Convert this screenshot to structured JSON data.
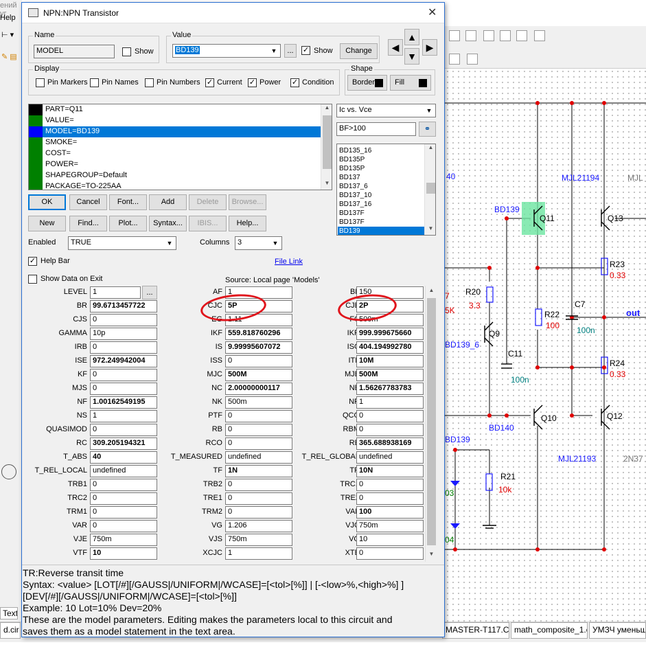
{
  "background": {
    "left_menu": [
      "ений уг",
      "Help"
    ],
    "labels_blue": [
      "BD139",
      "MJL21194",
      "BD140",
      "MJL21193",
      "BD139_6",
      "out",
      "BD139",
      "03",
      "04",
      "40"
    ],
    "components": {
      "q11": "Q11",
      "q13": "Q13",
      "q9": "Q9",
      "q10": "Q10",
      "q12": "Q12",
      "r20": "R20",
      "r20_val": "3.3",
      "r22": "R22",
      "r22_val": "100",
      "r23": "R23",
      "r23_val": "0.33",
      "r24": "R24",
      "r24_val": "0.33",
      "c7": "C7",
      "c7_val": "100n",
      "c11": "C11",
      "c11_val": "100n",
      "r21": "R21",
      "r21_val": "10k",
      "gray1": "MJL",
      "gray2": "2N37",
      "partial_5k": "5K",
      "partial_7": "7"
    },
    "tabs": [
      "d.cir",
      "MASTER-T117.CIR",
      "math_composite_1.cir",
      "УМЗЧ уменьше"
    ],
    "text_tab": "Text"
  },
  "dialog": {
    "title": "NPN:NPN Transistor",
    "name_group": {
      "label": "Name",
      "value": "MODEL",
      "show_label": "Show"
    },
    "value_group": {
      "label": "Value",
      "value": "BD139",
      "ellipsis": "...",
      "show_label": "Show",
      "show_checked": "✓",
      "change": "Change"
    },
    "display_group": {
      "label": "Display",
      "items": [
        {
          "label": "Pin Markers",
          "checked": ""
        },
        {
          "label": "Pin Names",
          "checked": ""
        },
        {
          "label": "Pin Numbers",
          "checked": ""
        },
        {
          "label": "Current",
          "checked": "✓"
        },
        {
          "label": "Power",
          "checked": "✓"
        },
        {
          "label": "Condition",
          "checked": "✓"
        }
      ]
    },
    "shape_group": {
      "label": "Shape",
      "border": "Border",
      "fill": "Fill"
    },
    "attributes": [
      {
        "text": "PART=Q11",
        "color": "#000000"
      },
      {
        "text": "VALUE=",
        "color": "#008000"
      },
      {
        "text": "MODEL=BD139",
        "color": "#0000ff"
      },
      {
        "text": "SMOKE=",
        "color": "#008000"
      },
      {
        "text": "COST=",
        "color": "#008000"
      },
      {
        "text": "POWER=",
        "color": "#008000"
      },
      {
        "text": "SHAPEGROUP=Default",
        "color": "#008000"
      },
      {
        "text": "PACKAGE=TO-225AA",
        "color": "#008000"
      }
    ],
    "plot_select": "Ic vs. Vce",
    "filter_value": "BF>100",
    "models": [
      "BD135_16",
      "BD135P",
      "BD135P",
      "BD137",
      "BD137_6",
      "BD137_10",
      "BD137_16",
      "BD137F",
      "BD137F",
      "BD139"
    ],
    "buttons_row1": [
      "OK",
      "Cancel",
      "Font...",
      "Add",
      "Delete",
      "Browse..."
    ],
    "buttons_row2": [
      "New",
      "Find...",
      "Plot...",
      "Syntax...",
      "IBIS...",
      "Help..."
    ],
    "enabled_label": "Enabled",
    "enabled_value": "TRUE",
    "columns_label": "Columns",
    "columns_value": "3",
    "help_bar_label": "Help Bar",
    "help_bar_checked": "✓",
    "file_link": "File Link",
    "show_data_label": "Show Data on Exit",
    "source_label": "Source: Local page 'Models'",
    "params": [
      [
        {
          "n": "LEVEL",
          "v": "1"
        },
        {
          "n": "AF",
          "v": "1"
        },
        {
          "n": "BF",
          "v": "150"
        }
      ],
      [
        {
          "n": "BR",
          "v": "99.6713457722",
          "b": true
        },
        {
          "n": "CJC",
          "v": "5P",
          "b": true
        },
        {
          "n": "CJE",
          "v": "2P",
          "b": true
        }
      ],
      [
        {
          "n": "CJS",
          "v": "0"
        },
        {
          "n": "EG",
          "v": "1.11"
        },
        {
          "n": "FC",
          "v": "500m"
        }
      ],
      [
        {
          "n": "GAMMA",
          "v": "10p"
        },
        {
          "n": "IKF",
          "v": "559.818760296",
          "b": true
        },
        {
          "n": "IKR",
          "v": "999.999675660",
          "b": true
        }
      ],
      [
        {
          "n": "IRB",
          "v": "0"
        },
        {
          "n": "IS",
          "v": "9.99995607072",
          "b": true
        },
        {
          "n": "ISC",
          "v": "404.194992780",
          "b": true
        }
      ],
      [
        {
          "n": "ISE",
          "v": "972.249942004",
          "b": true
        },
        {
          "n": "ISS",
          "v": "0"
        },
        {
          "n": "ITF",
          "v": "10M",
          "b": true
        }
      ],
      [
        {
          "n": "KF",
          "v": "0"
        },
        {
          "n": "MJC",
          "v": "500M",
          "b": true
        },
        {
          "n": "MJE",
          "v": "500M",
          "b": true
        }
      ],
      [
        {
          "n": "MJS",
          "v": "0"
        },
        {
          "n": "NC",
          "v": "2.00000000117",
          "b": true
        },
        {
          "n": "NE",
          "v": "1.56267783783",
          "b": true
        }
      ],
      [
        {
          "n": "NF",
          "v": "1.00162549195",
          "b": true
        },
        {
          "n": "NK",
          "v": "500m"
        },
        {
          "n": "NR",
          "v": "1"
        }
      ],
      [
        {
          "n": "NS",
          "v": "1"
        },
        {
          "n": "PTF",
          "v": "0"
        },
        {
          "n": "QCO",
          "v": "0"
        }
      ],
      [
        {
          "n": "QUASIMOD",
          "v": "0"
        },
        {
          "n": "RB",
          "v": "0"
        },
        {
          "n": "RBM",
          "v": "0"
        }
      ],
      [
        {
          "n": "RC",
          "v": "309.205194321",
          "b": true
        },
        {
          "n": "RCO",
          "v": "0"
        },
        {
          "n": "RE",
          "v": "365.688938169",
          "b": true
        }
      ],
      [
        {
          "n": "T_ABS",
          "v": "40",
          "b": true
        },
        {
          "n": "T_MEASURED",
          "v": "undefined"
        },
        {
          "n": "T_REL_GLOBAL",
          "v": "undefined"
        }
      ],
      [
        {
          "n": "T_REL_LOCAL",
          "v": "undefined"
        },
        {
          "n": "TF",
          "v": "1N",
          "b": true
        },
        {
          "n": "TR",
          "v": "10N",
          "b": true
        }
      ],
      [
        {
          "n": "TRB1",
          "v": "0"
        },
        {
          "n": "TRB2",
          "v": "0"
        },
        {
          "n": "TRC1",
          "v": "0"
        }
      ],
      [
        {
          "n": "TRC2",
          "v": "0"
        },
        {
          "n": "TRE1",
          "v": "0"
        },
        {
          "n": "TRE2",
          "v": "0"
        }
      ],
      [
        {
          "n": "TRM1",
          "v": "0"
        },
        {
          "n": "TRM2",
          "v": "0"
        },
        {
          "n": "VAF",
          "v": "100",
          "b": true
        }
      ],
      [
        {
          "n": "VAR",
          "v": "0"
        },
        {
          "n": "VG",
          "v": "1.206"
        },
        {
          "n": "VJC",
          "v": "750m"
        }
      ],
      [
        {
          "n": "VJE",
          "v": "750m"
        },
        {
          "n": "VJS",
          "v": "750m"
        },
        {
          "n": "VO",
          "v": "10"
        }
      ],
      [
        {
          "n": "VTF",
          "v": "10",
          "b": true
        },
        {
          "n": "XCJC",
          "v": "1"
        },
        {
          "n": "XTB",
          "v": "0"
        }
      ]
    ],
    "help_lines": [
      "TR:Reverse transit time",
      "Syntax: <value> [LOT[/#][/GAUSS|/UNIFORM|/WCASE]=[<tol>[%]] | [-<low>%,<high>%] ]",
      "[DEV[/#][/GAUSS|/UNIFORM|/WCASE]=[<tol>[%]]",
      "Example: 10 Lot=10% Dev=20%",
      "These are the model parameters. Editing makes the parameters local to this circuit and",
      "saves them as a model statement in the text area."
    ]
  }
}
